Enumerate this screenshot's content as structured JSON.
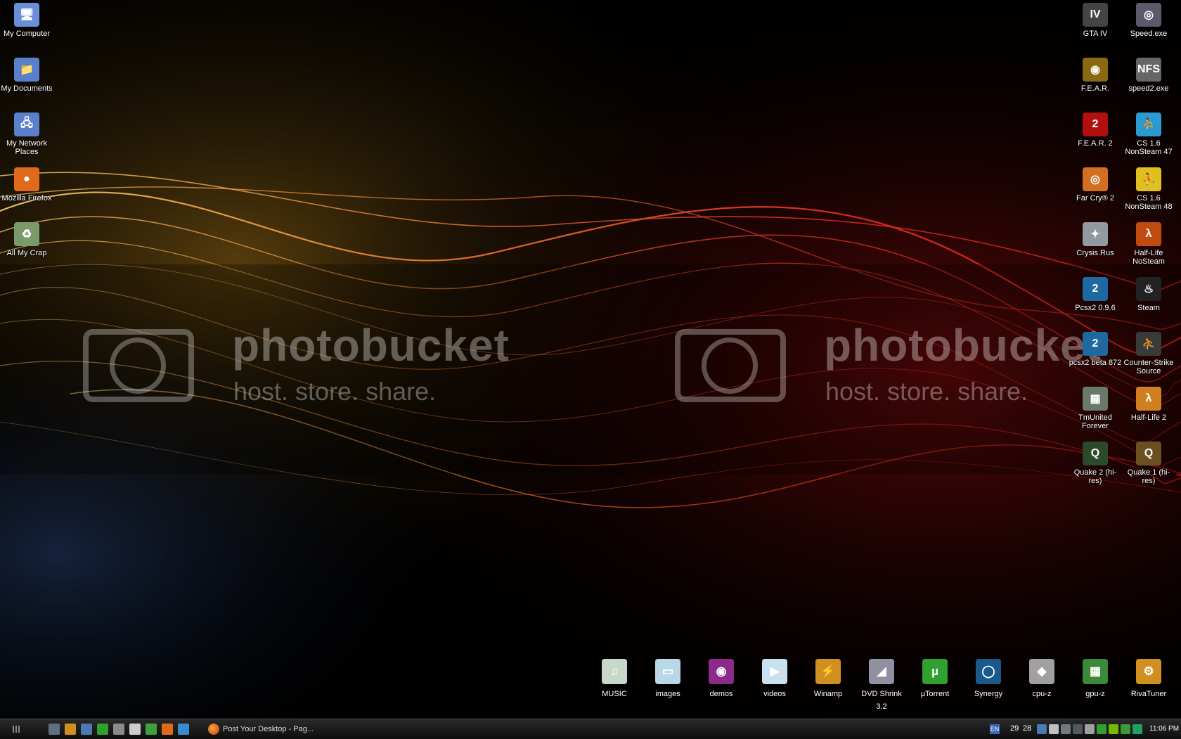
{
  "desktop": {
    "left_icons": [
      {
        "label": "My Computer",
        "icon": "computer-icon",
        "color": "#6a8fd8",
        "glyph": "🖥"
      },
      {
        "label": "My Documents",
        "icon": "folder-icon",
        "color": "#5a7fcc",
        "glyph": "📁"
      },
      {
        "label": "My Network Places",
        "icon": "network-icon",
        "color": "#5a7fcc",
        "glyph": "🖧"
      },
      {
        "label": "Mozilla Firefox",
        "icon": "firefox-icon",
        "color": "#e06a1a",
        "glyph": "●"
      },
      {
        "label": "All My Crap",
        "icon": "recycle-bin-icon",
        "color": "#7a9a6a",
        "glyph": "♻"
      }
    ],
    "right_col1": [
      {
        "label": "GTA IV",
        "icon": "gta-iv-icon",
        "color": "#444444",
        "glyph": "IV"
      },
      {
        "label": "F.E.A.R.",
        "icon": "fear-icon",
        "color": "#8a6a10",
        "glyph": "◉"
      },
      {
        "label": "F.E.A.R. 2",
        "icon": "fear2-icon",
        "color": "#b01010",
        "glyph": "2"
      },
      {
        "label": "Far Cry® 2",
        "icon": "farcry2-icon",
        "color": "#d07020",
        "glyph": "◎"
      },
      {
        "label": "Crysis.Rus",
        "icon": "crysis-icon",
        "color": "#909aa0",
        "glyph": "✦"
      },
      {
        "label": "Pcsx2 0.9.6",
        "icon": "pcsx2-icon",
        "color": "#1e6aa0",
        "glyph": "2"
      },
      {
        "label": "pcsx2 beta 872",
        "icon": "pcsx2-beta-icon",
        "color": "#1e6aa0",
        "glyph": "2"
      },
      {
        "label": "TmUnited Forever",
        "icon": "trackmania-icon",
        "color": "#6a7a6a",
        "glyph": "▦"
      },
      {
        "label": "Quake 2 (hi-res)",
        "icon": "quake2-icon",
        "color": "#2a4a2a",
        "glyph": "Q"
      }
    ],
    "right_col2": [
      {
        "label": "Speed.exe",
        "icon": "speed-exe-icon",
        "color": "#5a5a6a",
        "glyph": "◎"
      },
      {
        "label": "speed2.exe",
        "icon": "nfs-icon",
        "color": "#666666",
        "glyph": "NFS"
      },
      {
        "label": "CS 1.6 NonSteam 47",
        "icon": "cs16-icon",
        "color": "#2a9ad0",
        "glyph": "⛹"
      },
      {
        "label": "CS 1.6 NonSteam 48",
        "icon": "cs16-icon-2",
        "color": "#e0c020",
        "glyph": "⛹"
      },
      {
        "label": "Half-Life NoSteam",
        "icon": "half-life-icon",
        "color": "#c04a10",
        "glyph": "λ"
      },
      {
        "label": "Steam",
        "icon": "steam-icon",
        "color": "#222222",
        "glyph": "♨"
      },
      {
        "label": "Counter-Strike Source",
        "icon": "css-icon",
        "color": "#3a3a3a",
        "glyph": "⛹"
      },
      {
        "label": "Half-Life 2",
        "icon": "half-life-2-icon",
        "color": "#d08020",
        "glyph": "λ"
      },
      {
        "label": "Quake 1 (hi-res)",
        "icon": "quake1-icon",
        "color": "#6a5020",
        "glyph": "Q"
      }
    ],
    "dock": [
      {
        "label": "MUSIC",
        "icon": "music-folder-icon",
        "color": "#c8d8c8",
        "glyph": "♫"
      },
      {
        "label": "images",
        "icon": "images-folder-icon",
        "color": "#b8d8e8",
        "glyph": "▭"
      },
      {
        "label": "demos",
        "icon": "demos-folder-icon",
        "color": "#8a2a8a",
        "glyph": "◉"
      },
      {
        "label": "videos",
        "icon": "videos-folder-icon",
        "color": "#c8e0f0",
        "glyph": "▶"
      },
      {
        "label": "Winamp",
        "icon": "winamp-icon",
        "color": "#d09020",
        "glyph": "⚡"
      },
      {
        "label": "DVD Shrink 3.2",
        "icon": "dvd-shrink-icon",
        "color": "#9090a0",
        "glyph": "◢"
      },
      {
        "label": "µTorrent",
        "icon": "utorrent-icon",
        "color": "#30a030",
        "glyph": "µ"
      },
      {
        "label": "Synergy",
        "icon": "synergy-icon",
        "color": "#1a5a8a",
        "glyph": "◯"
      },
      {
        "label": "cpu-z",
        "icon": "cpu-z-icon",
        "color": "#a0a0a0",
        "glyph": "◆"
      },
      {
        "label": "gpu-z",
        "icon": "gpu-z-icon",
        "color": "#3a8a3a",
        "glyph": "▦"
      },
      {
        "label": "RivaTuner",
        "icon": "rivatuner-icon",
        "color": "#d09020",
        "glyph": "⚙"
      }
    ],
    "watermark": {
      "brand": "photobucket",
      "tagline": "host. store. share."
    }
  },
  "taskbar": {
    "quick_launch": [
      {
        "icon": "show-desktop-icon",
        "color": "#607080"
      },
      {
        "icon": "winamp-quicklaunch-icon",
        "color": "#d09020"
      },
      {
        "icon": "quicklaunch-app-icon",
        "color": "#4a7ab0"
      },
      {
        "icon": "utorrent-quicklaunch-icon",
        "color": "#30a030"
      },
      {
        "icon": "quicklaunch-app-icon-2",
        "color": "#8a8a8a"
      },
      {
        "icon": "steam-quicklaunch-icon",
        "color": "#cccccc"
      },
      {
        "icon": "messenger-icon",
        "color": "#40a040"
      },
      {
        "icon": "firefox-quicklaunch-icon",
        "color": "#e06a1a"
      },
      {
        "icon": "virtualbox-icon",
        "color": "#3a8ad0"
      }
    ],
    "active_window": "Post Your Desktop - Pag...",
    "tray": {
      "language": "EN",
      "num1": "29",
      "num2": "28",
      "clock": "11:06 PM",
      "icons": [
        "download-icon",
        "tray-app-icon",
        "monitor-icon",
        "network-tray-icon",
        "tray-app-icon-2",
        "utorrent-tray-icon",
        "nvidia-icon",
        "tray-app-icon-3",
        "tray-app-icon-4"
      ]
    }
  }
}
